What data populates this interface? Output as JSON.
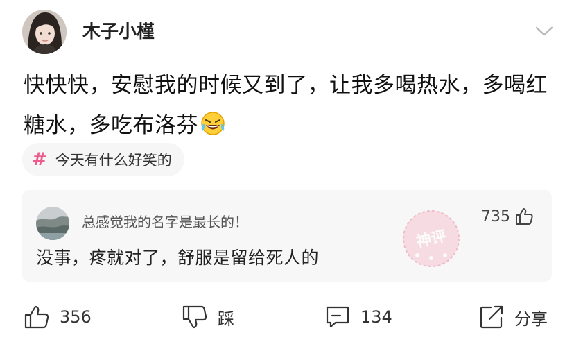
{
  "post": {
    "username": "木子小槿",
    "text": "快快快，安慰我的时候又到了，让我多喝热水，多喝红糖水，多吃布洛芬",
    "emoji": "rofl-emoji",
    "topic": {
      "hash_symbol": "#",
      "label": "今天有什么好笑的"
    }
  },
  "comment": {
    "author": "总感觉我的名字是最长的！",
    "likes": "735",
    "text": "没事，疼就对了，舒服是留给死人的",
    "badge": "神评"
  },
  "actions": {
    "like_count": "356",
    "dislike_label": "踩",
    "comment_count": "134",
    "share_label": "分享"
  },
  "colors": {
    "accent_pink": "#ef5b8e",
    "card_bg": "#f7f7f7",
    "topic_bg": "#f6f6f6",
    "stamp_pink": "#e8728f"
  }
}
